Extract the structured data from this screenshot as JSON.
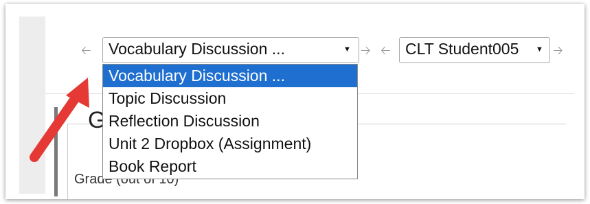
{
  "heading": "G",
  "grade_label": "Grade (out of 10)",
  "activity_select": {
    "selected": "Vocabulary Discussion ...",
    "options": [
      "Vocabulary Discussion ...",
      "Topic Discussion",
      "Reflection Discussion",
      "Unit 2 Dropbox (Assignment)",
      "Book Report"
    ]
  },
  "student_select": {
    "selected": "CLT Student005"
  },
  "icons": {
    "prev": "arrow-left-icon",
    "next": "arrow-right-icon",
    "caret": "caret-down-icon"
  },
  "colors": {
    "highlight": "#1e6fd0",
    "annotation": "#e53935"
  }
}
